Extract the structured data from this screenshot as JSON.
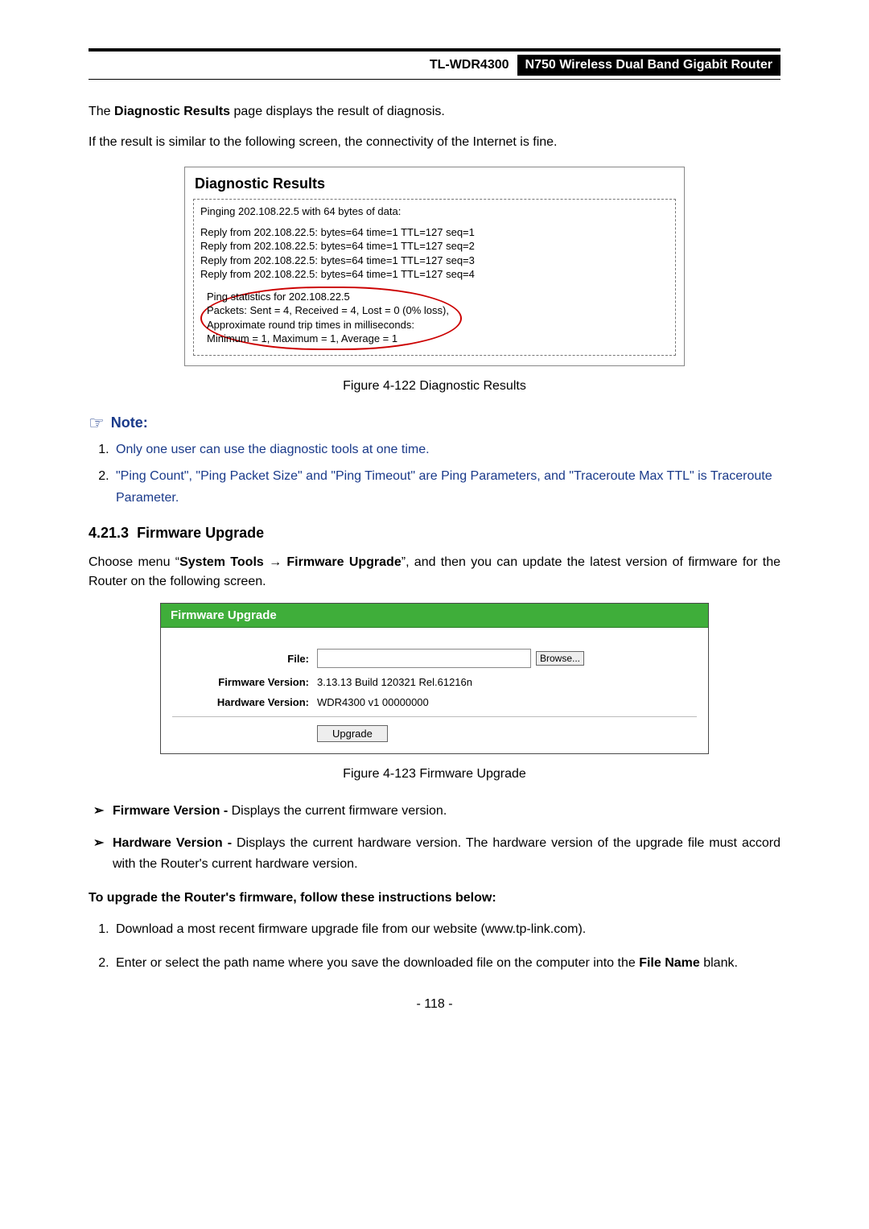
{
  "header": {
    "model": "TL-WDR4300",
    "product": "N750 Wireless Dual Band Gigabit Router"
  },
  "intro1_pre": "The ",
  "intro1_bold": "Diagnostic Results",
  "intro1_post": " page displays the result of diagnosis.",
  "intro2": "If the result is similar to the following screen, the connectivity of the Internet is fine.",
  "diag": {
    "title": "Diagnostic Results",
    "line_ping": "Pinging 202.108.22.5 with 64 bytes of data:",
    "r1": "Reply from 202.108.22.5:  bytes=64  time=1  TTL=127  seq=1",
    "r2": "Reply from 202.108.22.5:  bytes=64  time=1  TTL=127  seq=2",
    "r3": "Reply from 202.108.22.5:  bytes=64  time=1  TTL=127  seq=3",
    "r4": "Reply from 202.108.22.5:  bytes=64  time=1  TTL=127  seq=4",
    "s1": "Ping statistics for 202.108.22.5",
    "s2": "  Packets: Sent = 4, Received = 4, Lost = 0 (0% loss),",
    "s3": "Approximate round trip times in milliseconds:",
    "s4": "  Minimum = 1, Maximum = 1, Average = 1"
  },
  "caption1": "Figure 4-122 Diagnostic Results",
  "note_label": "Note:",
  "note1": "Only one user can use the diagnostic tools at one time.",
  "note2": "\"Ping Count\", \"Ping Packet Size\" and \"Ping Timeout\" are Ping Parameters, and \"Traceroute Max TTL\" is Traceroute Parameter.",
  "section_num": "4.21.3",
  "section_title": "Firmware Upgrade",
  "choose_pre": "Choose menu “",
  "choose_b1": "System Tools",
  "choose_arrow": " → ",
  "choose_b2": "Firmware Upgrade",
  "choose_post": "”, and then you can update the latest version of firmware for the Router on the following screen.",
  "fw": {
    "panel_title": "Firmware Upgrade",
    "file_label": "File:",
    "browse": "Browse...",
    "fw_ver_label": "Firmware Version:",
    "fw_ver_value": "3.13.13 Build 120321 Rel.61216n",
    "hw_ver_label": "Hardware Version:",
    "hw_ver_value": "WDR4300 v1 00000000",
    "upgrade": "Upgrade"
  },
  "caption2": "Figure 4-123 Firmware Upgrade",
  "bullet_mark": "➢",
  "bul1_b": "Firmware Version -",
  "bul1_t": " Displays the current firmware version.",
  "bul2_b": "Hardware Version -",
  "bul2_t": " Displays the current hardware version. The hardware version of the upgrade file must accord with the Router's current hardware version.",
  "instr_heading": "To upgrade the Router's firmware, follow these instructions below:",
  "step1": "Download a most recent firmware upgrade file from our website (www.tp-link.com).",
  "step2_pre": "Enter or select the path name where you save the downloaded file on the computer into the ",
  "step2_b": "File Name",
  "step2_post": " blank.",
  "page_number": "- 118 -"
}
